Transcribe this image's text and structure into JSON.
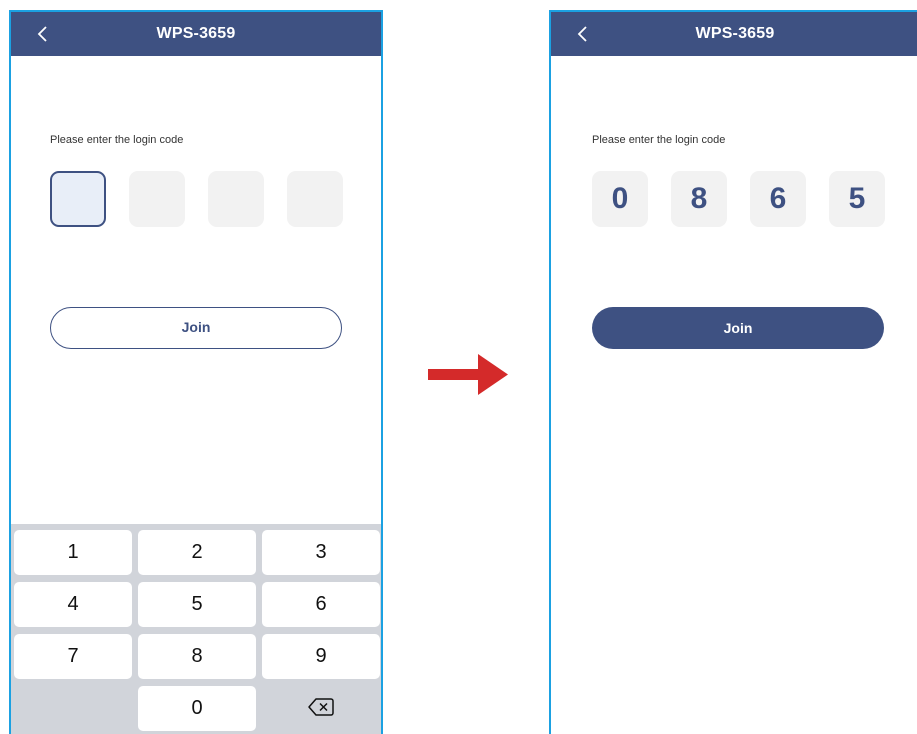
{
  "left_screen": {
    "title": "WPS-3659",
    "prompt": "Please enter the login code",
    "code_digits": [
      "",
      "",
      "",
      ""
    ],
    "join_label": "Join",
    "keypad": [
      "1",
      "2",
      "3",
      "4",
      "5",
      "6",
      "7",
      "8",
      "9",
      "",
      "0",
      "delete-icon"
    ]
  },
  "right_screen": {
    "title": "WPS-3659",
    "prompt": "Please enter the login code",
    "code_digits": [
      "0",
      "8",
      "6",
      "5"
    ],
    "join_label": "Join"
  },
  "colors": {
    "header": "#3e5182",
    "frame": "#1ba1e2",
    "arrow": "#d42a2a",
    "keypad_bg": "#d1d4da"
  },
  "icons": [
    "back-chevron-icon",
    "arrow-right-icon",
    "backspace-icon"
  ]
}
